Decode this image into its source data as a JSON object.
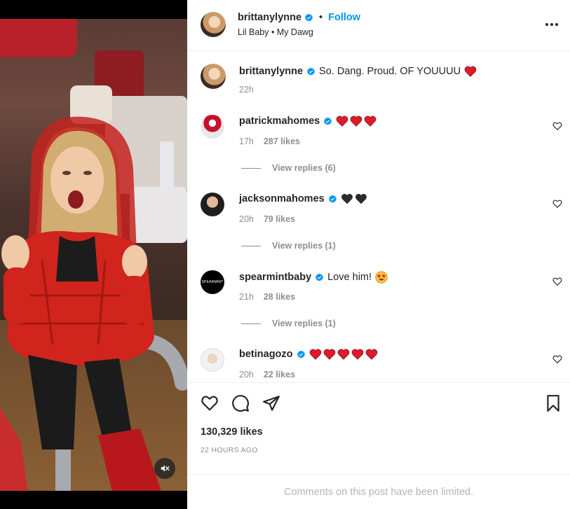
{
  "header": {
    "username": "brittanylynne",
    "follow_label": "Follow",
    "separator": "•",
    "audio": "Lil Baby • My Dawg"
  },
  "caption": {
    "username": "brittanylynne",
    "text": "So. Dang. Proud. OF YOUUUU",
    "time": "22h"
  },
  "comments": [
    {
      "username": "patrickmahomes",
      "text": "",
      "hearts": 3,
      "heart_color": "#e0192b",
      "time": "17h",
      "likes": "287 likes",
      "replies": "View replies (6)"
    },
    {
      "username": "jacksonmahomes",
      "text": "",
      "hearts": 2,
      "heart_color": "#2b2b2b",
      "time": "20h",
      "likes": "79 likes",
      "replies": "View replies (1)"
    },
    {
      "username": "spearmintbaby",
      "text": "Love him!",
      "avatar_text": "SPEARMINT",
      "time": "21h",
      "likes": "28 likes",
      "replies": "View replies (1)"
    },
    {
      "username": "betinagozo",
      "text": "",
      "hearts": 5,
      "heart_color": "#e0192b",
      "time": "20h",
      "likes": "22 likes",
      "replies": ""
    }
  ],
  "stats": {
    "likes": "130,329 likes",
    "time_ago": "22 HOURS AGO"
  },
  "footer": {
    "limited_text": "Comments on this post have been limited."
  },
  "colors": {
    "accent": "#0095f6",
    "verified": "#0095f6",
    "red_heart": "#e0192b",
    "black_heart": "#2b2b2b"
  },
  "icons": [
    "verified-badge-icon",
    "more-options-icon",
    "like-icon",
    "comment-icon",
    "share-icon",
    "save-icon",
    "mute-icon",
    "heart-emoji-icon",
    "star-struck-emoji-icon"
  ]
}
